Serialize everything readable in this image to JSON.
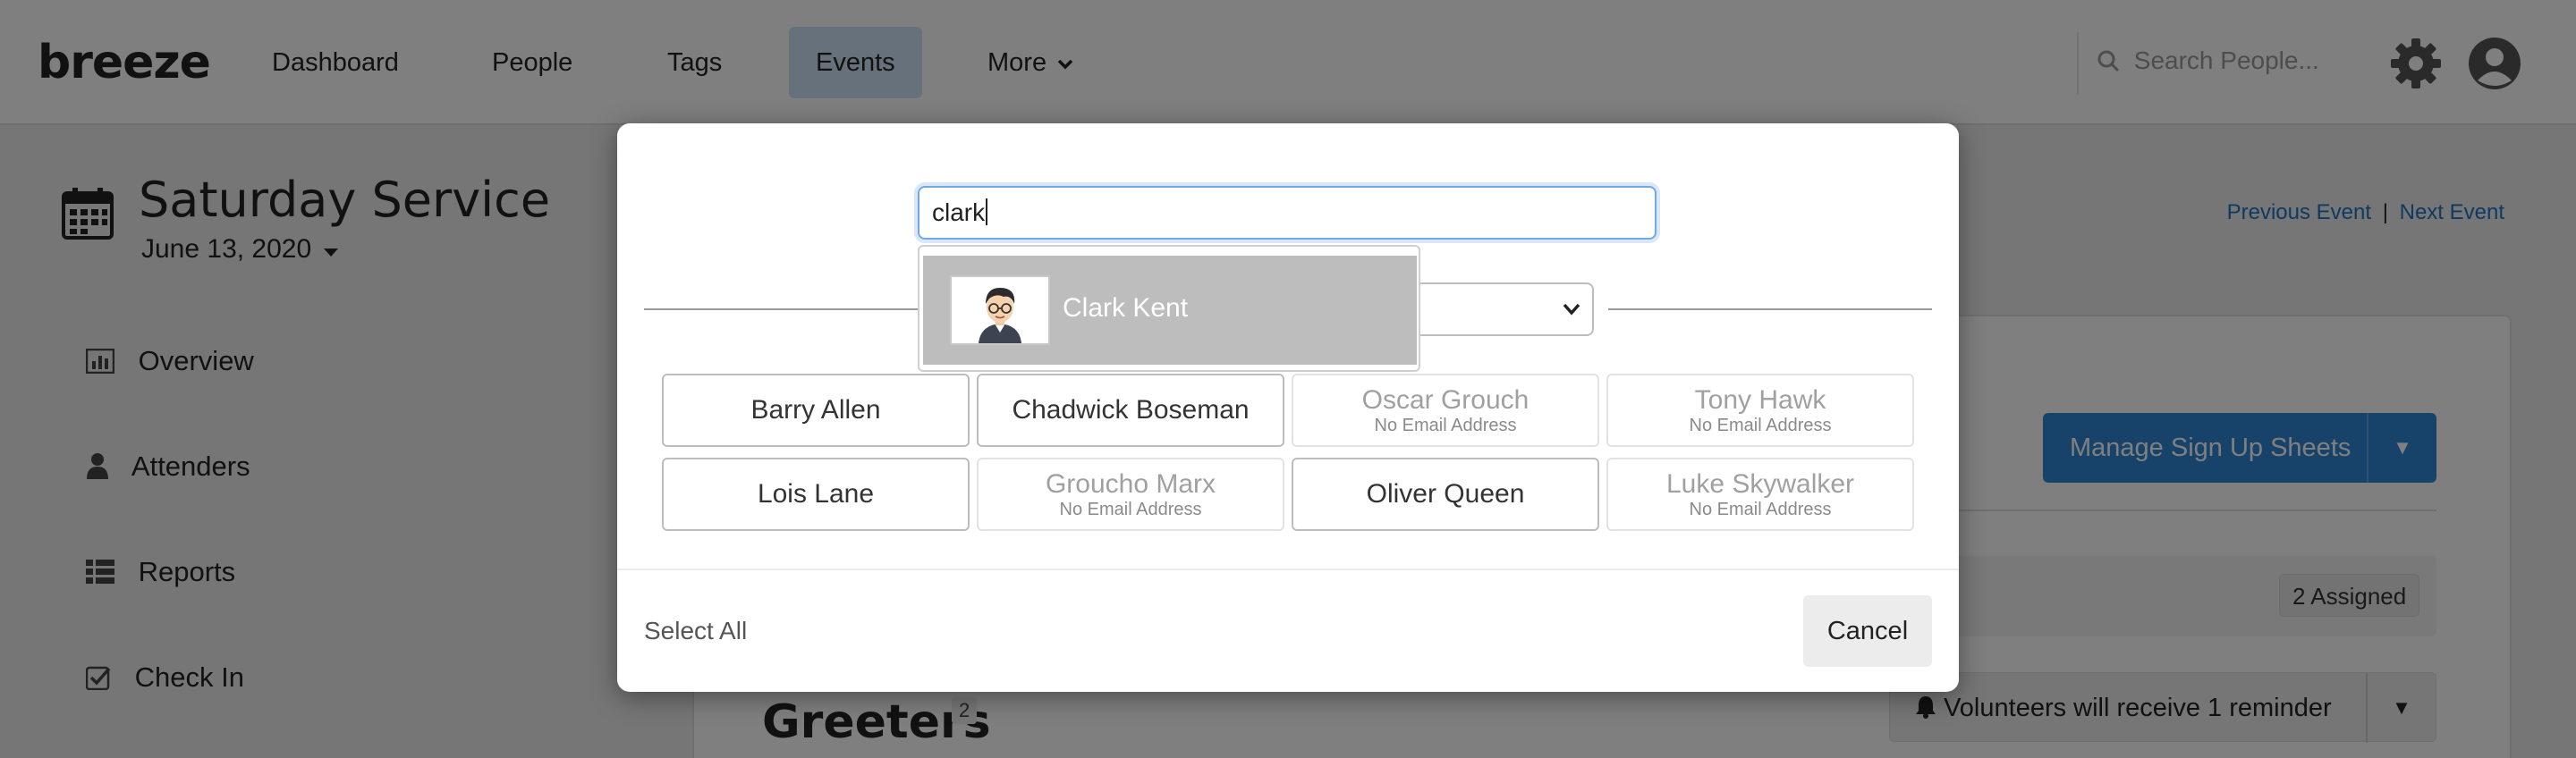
{
  "nav": {
    "logo": "breeze",
    "items": [
      {
        "label": "Dashboard"
      },
      {
        "label": "People"
      },
      {
        "label": "Tags"
      },
      {
        "label": "Events"
      },
      {
        "label": "More"
      }
    ],
    "active_item": "Events",
    "search_placeholder": "Search People..."
  },
  "event": {
    "title": "Saturday Service",
    "date": "June 13, 2020",
    "prev_label": "Previous Event",
    "separator": "|",
    "next_label": "Next Event"
  },
  "sidebar": {
    "items": [
      {
        "label": "Overview",
        "icon": "bar-chart-icon"
      },
      {
        "label": "Attenders",
        "icon": "person-icon"
      },
      {
        "label": "Reports",
        "icon": "grid-icon"
      },
      {
        "label": "Check In",
        "icon": "checkbox-icon"
      }
    ]
  },
  "panel": {
    "manage_label": "Manage Sign Up Sheets",
    "assigned_label": "2 Assigned",
    "section_title": "Greeters",
    "section_count": "2",
    "reminder_label": "Volunteers will receive 1 reminder"
  },
  "modal": {
    "search_value": "clark",
    "suggestion": {
      "name": "Clark Kent"
    },
    "people": [
      {
        "name": "Barry Allen",
        "sub": "",
        "enabled": true
      },
      {
        "name": "Chadwick Boseman",
        "sub": "",
        "enabled": true
      },
      {
        "name": "Oscar Grouch",
        "sub": "No Email Address",
        "enabled": false
      },
      {
        "name": "Tony Hawk",
        "sub": "No Email Address",
        "enabled": false
      },
      {
        "name": "Lois Lane",
        "sub": "",
        "enabled": true
      },
      {
        "name": "Groucho Marx",
        "sub": "No Email Address",
        "enabled": false
      },
      {
        "name": "Oliver Queen",
        "sub": "",
        "enabled": true
      },
      {
        "name": "Luke Skywalker",
        "sub": "No Email Address",
        "enabled": false
      }
    ],
    "select_all_label": "Select All",
    "cancel_label": "Cancel"
  },
  "colors": {
    "accent": "#2f87d6",
    "overlay": "rgba(0,0,0,0.5)",
    "active_nav": "#cfe3f6",
    "suggestion_bg": "#bdbdbd"
  }
}
